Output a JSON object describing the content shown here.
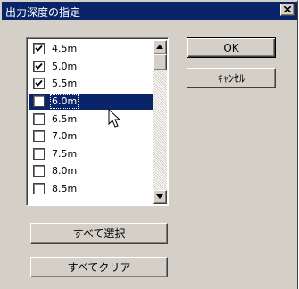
{
  "window": {
    "title": "出力深度の指定",
    "close_icon": "close-x-icon"
  },
  "depth_list": {
    "items": [
      {
        "label": "4.5m",
        "checked": true,
        "selected": false
      },
      {
        "label": "5.0m",
        "checked": true,
        "selected": false
      },
      {
        "label": "5.5m",
        "checked": true,
        "selected": false
      },
      {
        "label": "6.0m",
        "checked": false,
        "selected": true
      },
      {
        "label": "6.5m",
        "checked": false,
        "selected": false
      },
      {
        "label": "7.0m",
        "checked": false,
        "selected": false
      },
      {
        "label": "7.5m",
        "checked": false,
        "selected": false
      },
      {
        "label": "8.0m",
        "checked": false,
        "selected": false
      },
      {
        "label": "8.5m",
        "checked": false,
        "selected": false
      }
    ],
    "scroll_up_icon": "scroll-up-arrow-icon",
    "scroll_down_icon": "scroll-down-arrow-icon"
  },
  "buttons": {
    "ok": "OK",
    "cancel": "ｷｬﾝｾﾙ",
    "select_all": "すべて選択",
    "clear_all": "すべてクリア"
  },
  "colors": {
    "titlebar": "#0a246a",
    "selection": "#0a246a",
    "face": "#d4d0c8"
  },
  "cursor_icon": "arrow-pointer-icon"
}
